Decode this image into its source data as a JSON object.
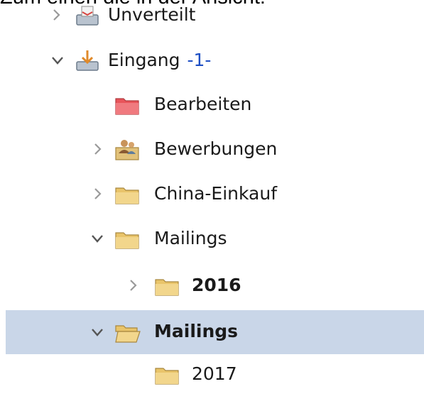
{
  "caption": "Zum einen die in der Ansicht:",
  "colors": {
    "selection": "#c9d6e8",
    "badge": "#1e4fc4",
    "folder_yellow": "#e9c46a",
    "folder_red": "#e8545a"
  },
  "tree": {
    "items": [
      {
        "label": "Unverteilt",
        "expander": "collapsed",
        "icon": "inbox-tray-icon"
      },
      {
        "label": "Eingang",
        "badge": "-1-",
        "expander": "expanded",
        "icon": "inbox-download-icon"
      },
      {
        "label": "Bearbeiten",
        "expander": "none",
        "icon": "red-folder-icon"
      },
      {
        "label": "Bewerbungen",
        "expander": "collapsed",
        "icon": "people-folder-icon"
      },
      {
        "label": "China-Einkauf",
        "expander": "collapsed",
        "icon": "folder-icon"
      },
      {
        "label": "Mailings",
        "expander": "expanded",
        "icon": "folder-icon"
      },
      {
        "label": "2016",
        "expander": "collapsed",
        "icon": "folder-icon",
        "bold": true
      },
      {
        "label": "Mailings",
        "expander": "expanded",
        "icon": "open-folder-icon",
        "bold": true,
        "selected": true
      },
      {
        "label": "2017",
        "expander": "none",
        "icon": "folder-icon"
      }
    ]
  }
}
